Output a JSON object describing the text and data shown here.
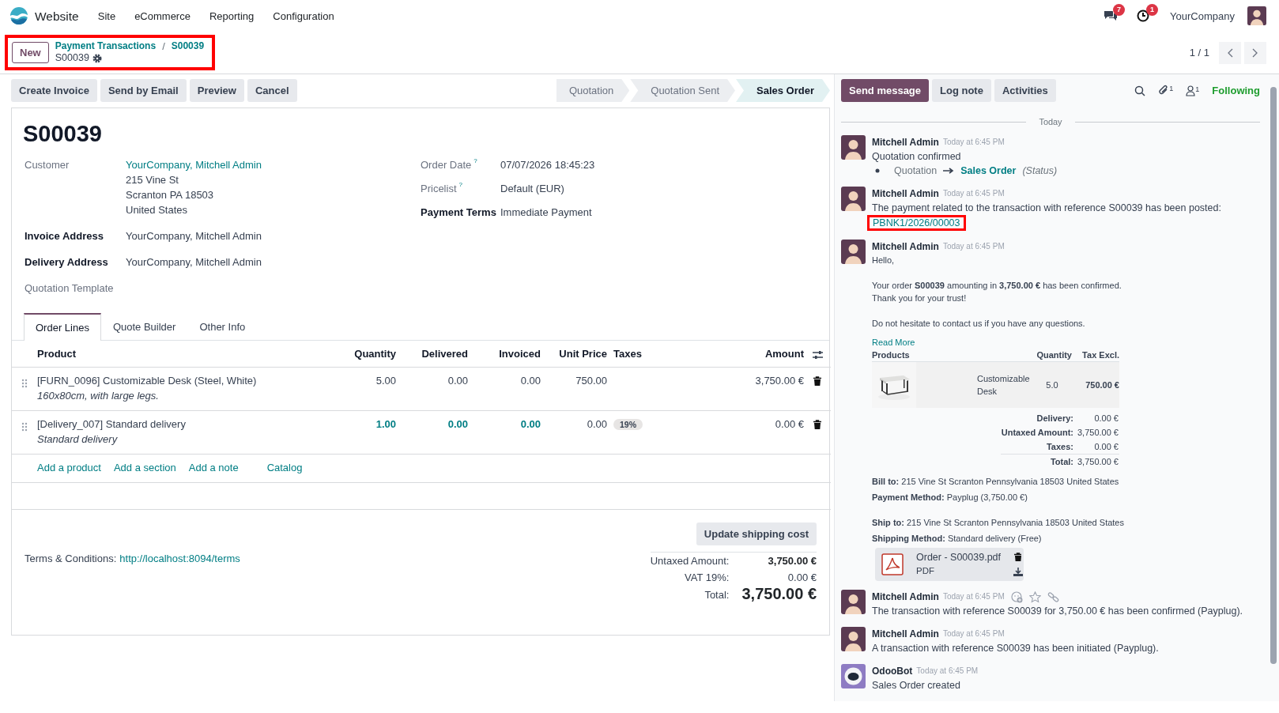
{
  "navbar": {
    "app": "Website",
    "menus": [
      "Site",
      "eCommerce",
      "Reporting",
      "Configuration"
    ],
    "messages_count": "7",
    "activities_count": "1",
    "company": "YourCompany"
  },
  "control_panel": {
    "new_button": "New",
    "breadcrumbs": [
      "Payment Transactions",
      "S00039"
    ],
    "separator": "/",
    "record": "S00039",
    "annotated": true,
    "pager": "1 / 1"
  },
  "actions": [
    "Create Invoice",
    "Send by Email",
    "Preview",
    "Cancel"
  ],
  "status_steps": [
    {
      "label": "Quotation",
      "selected": false
    },
    {
      "label": "Quotation Sent",
      "selected": false
    },
    {
      "label": "Sales Order",
      "selected": true
    }
  ],
  "form": {
    "title": "S00039",
    "left_fields": [
      {
        "label": "Customer",
        "strong": false,
        "value": "YourCompany, Mitchell Admin",
        "link": true,
        "address": [
          "215 Vine St",
          "Scranton PA 18503",
          "United States"
        ]
      },
      {
        "label": "Invoice Address",
        "strong": true,
        "value": "YourCompany, Mitchell Admin",
        "link": false
      },
      {
        "label": "Delivery Address",
        "strong": true,
        "value": "YourCompany, Mitchell Admin",
        "link": false
      },
      {
        "label": "Quotation Template",
        "strong": false
      }
    ],
    "right_fields": [
      {
        "label": "Order Date",
        "help": "?",
        "strong": false,
        "value": "07/07/2026 18:45:23",
        "link": false
      },
      {
        "label": "Pricelist",
        "help": "?",
        "strong": false,
        "value": "Default (EUR)",
        "link": false
      },
      {
        "label": "Payment Terms",
        "strong": true,
        "value": "Immediate Payment",
        "link": false
      }
    ],
    "tabs": [
      {
        "label": "Order Lines",
        "selected": true
      },
      {
        "label": "Quote Builder",
        "selected": false
      },
      {
        "label": "Other Info",
        "selected": false
      }
    ],
    "columns": [
      "Product",
      "Quantity",
      "Delivered",
      "Invoiced",
      "Unit Price",
      "Taxes",
      "Amount"
    ],
    "rows": [
      {
        "product": "[FURN_0096] Customizable Desk (Steel, White)",
        "description": "160x80cm, with large legs.",
        "quantity": "5.00",
        "delivered": "0.00",
        "invoiced": "0.00",
        "unit_price": "750.00",
        "amount": "3,750.00 €",
        "emphasized": false
      },
      {
        "product": "[Delivery_007] Standard delivery",
        "description": "Standard delivery",
        "quantity": "1.00",
        "delivered": "0.00",
        "invoiced": "0.00",
        "unit_price": "0.00",
        "taxes": [
          "19%"
        ],
        "amount": "0.00 €",
        "emphasized": true
      }
    ],
    "add_links": [
      "Add a product",
      "Add a section",
      "Add a note",
      "Catalog"
    ],
    "update_button": "Update shipping cost",
    "terms_label": "Terms & Conditions:",
    "terms_link": "http://localhost:8094/terms",
    "totals": [
      {
        "kind": "subtotal",
        "label": "Untaxed Amount:",
        "value": "3,750.00 €"
      },
      {
        "kind": "tax",
        "label": "VAT 19%:",
        "value": "0.00 €"
      },
      {
        "kind": "grand",
        "label": "Total:",
        "value": "3,750.00 €"
      }
    ]
  },
  "chatter": {
    "buttons": [
      {
        "label": "Send message",
        "selected": true
      },
      {
        "label": "Log note",
        "selected": false
      },
      {
        "label": "Activities",
        "selected": false
      }
    ],
    "attachments_count": "1",
    "followers_count": "1",
    "following": "Following",
    "date_separator": "Today",
    "messages": [
      {
        "kind": "tracking",
        "bot": false,
        "author": "Mitchell Admin",
        "time": "Today at 6:45 PM",
        "body": "Quotation confirmed",
        "old_value": "Quotation",
        "new_value": "Sales Order",
        "field": "(Status)"
      },
      {
        "kind": "text",
        "bot": false,
        "author": "Mitchell Admin",
        "time": "Today at 6:45 PM",
        "body": "The payment related to the transaction with reference S00039 has been posted:",
        "link": "PBNK1/2026/00003",
        "annotated": true
      },
      {
        "kind": "email",
        "bot": false,
        "author": "Mitchell Admin",
        "time": "Today at 6:45 PM",
        "paragraphs": [
          [
            "Hello,"
          ],
          [
            "Your order **S00039** amounting in **3,750.00 €** has been confirmed.",
            "Thank you for your trust!"
          ],
          [
            "Do not hesitate to contact us if you have any questions."
          ]
        ],
        "read_more": "Read More",
        "product_columns": [
          "Products",
          "Quantity",
          "Tax Excl."
        ],
        "products": [
          {
            "name": "Customizable Desk",
            "quantity": "5.0",
            "price": "750.00 €"
          }
        ],
        "summary": [
          {
            "label": "Delivery:",
            "value": "0.00 €"
          },
          {
            "label": "Untaxed Amount:",
            "value": "3,750.00 €"
          },
          {
            "label": "Taxes:",
            "value": "0.00 €"
          },
          {
            "label": "Total:",
            "value": "3,750.00 €"
          }
        ],
        "details": [
          [
            "**Bill to:** 215 Vine St Scranton Pennsylvania 18503 United States",
            "**Payment Method:** Payplug (3,750.00 €)"
          ],
          [
            "**Ship to:** 215 Vine St Scranton Pennsylvania 18503 United States",
            "**Shipping Method:** Standard delivery (Free)"
          ]
        ],
        "attachment": {
          "name": "Order - S00039.pdf",
          "type": "PDF"
        }
      },
      {
        "kind": "text",
        "bot": false,
        "author": "Mitchell Admin",
        "time": "Today at 6:45 PM",
        "body": "The transaction with reference S00039 for 3,750.00 € has been confirmed (Payplug).",
        "hovered": true
      },
      {
        "kind": "text",
        "bot": false,
        "author": "Mitchell Admin",
        "time": "Today at 6:45 PM",
        "body": "A transaction with reference S00039 has been initiated (Payplug)."
      },
      {
        "kind": "text",
        "bot": true,
        "author": "OdooBot",
        "time": "Today at 6:45 PM",
        "body": "Sales Order created"
      }
    ]
  }
}
